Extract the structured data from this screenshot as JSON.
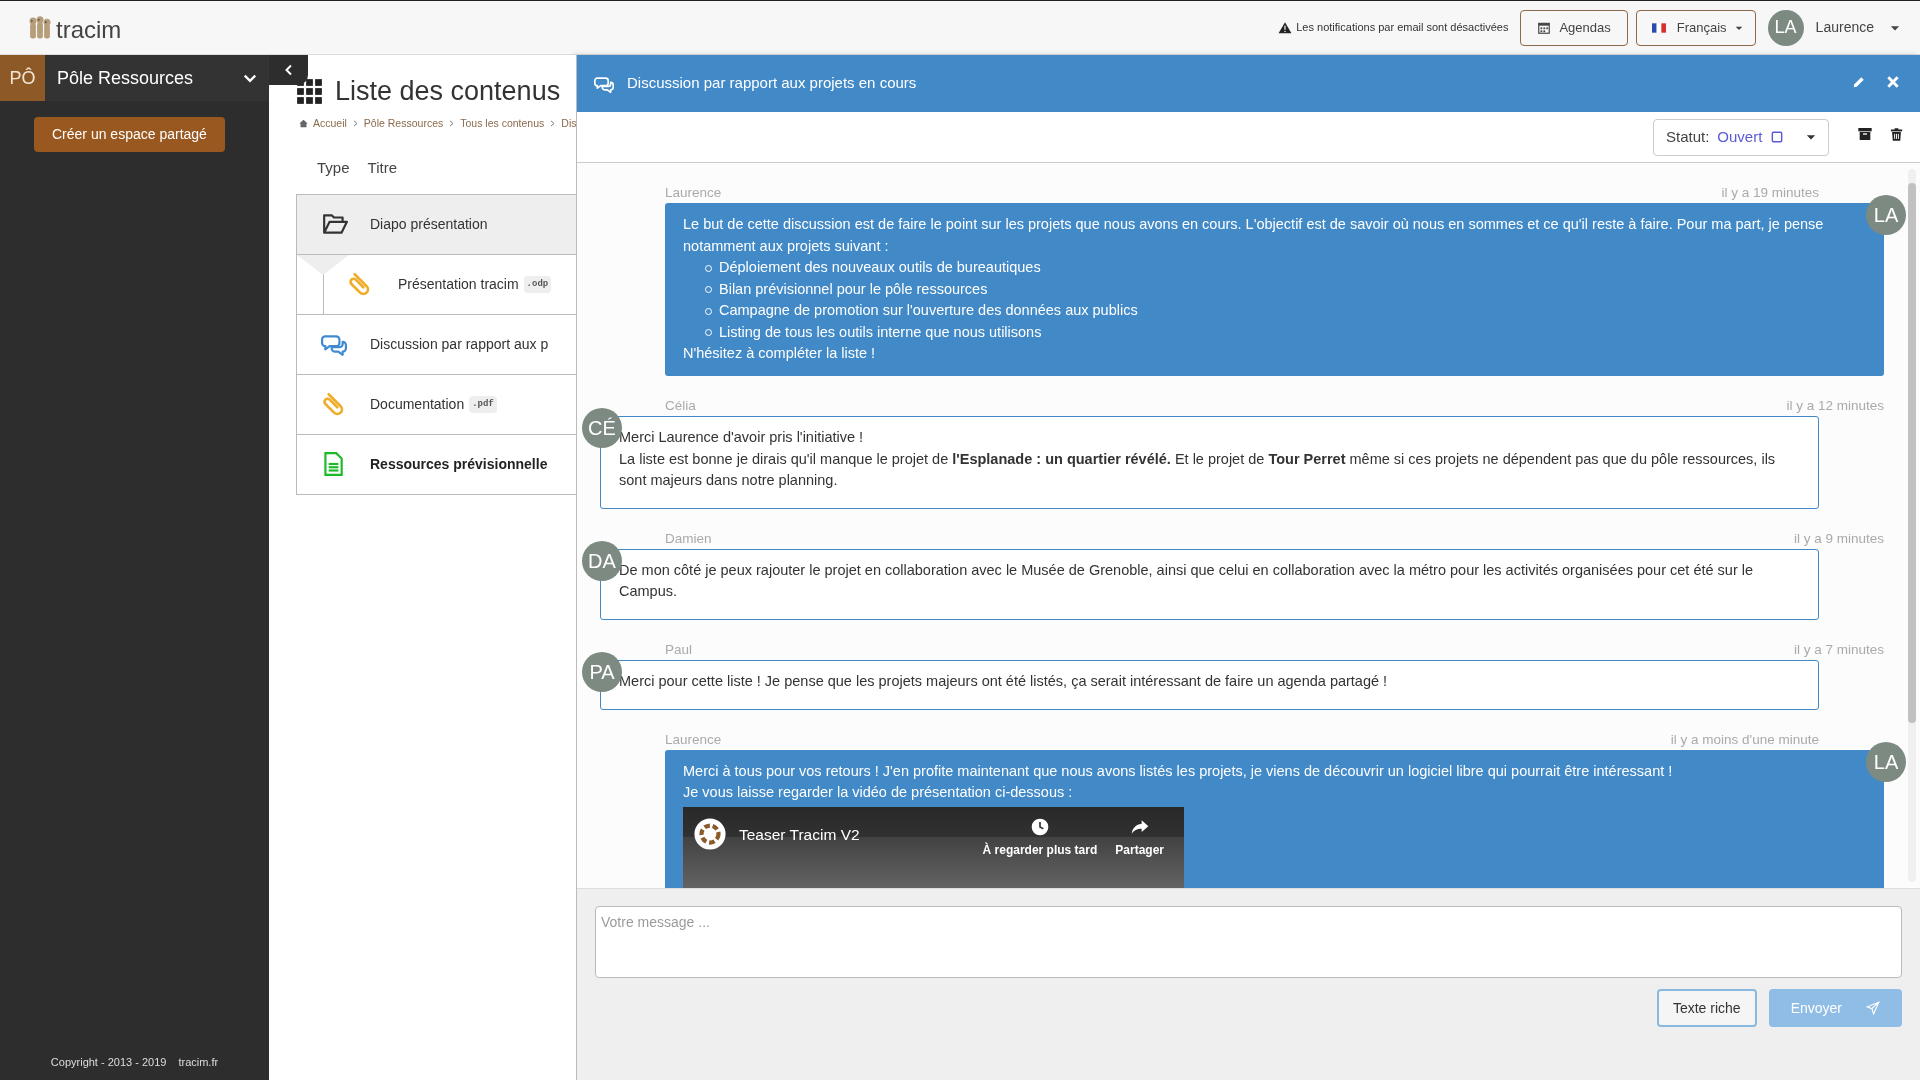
{
  "topbar": {
    "logo_text": "tracim",
    "notice": "Les notifications par email sont désactivées",
    "agendas_button": "Agendas",
    "language_button": "Français",
    "user": {
      "initials": "LA",
      "name": "Laurence"
    }
  },
  "sidebar": {
    "space": {
      "initials": "PÔ",
      "name": "Pôle Ressources"
    },
    "create_button": "Créer un espace partagé",
    "copyright": "Copyright - 2013 - 2019",
    "footer_link": "tracim.fr"
  },
  "content_list": {
    "title": "Liste des contenus",
    "breadcrumb": [
      "Accueil",
      "Pôle Ressources",
      "Tous les contenus",
      "Dis"
    ],
    "columns": [
      "Type",
      "Titre"
    ],
    "items": [
      {
        "kind": "folder",
        "label": "Diapo présentation",
        "expanded": true,
        "unread": false,
        "children": [
          {
            "kind": "file",
            "label": "Présentation tracim",
            "extension": ".odp",
            "unread": false
          }
        ]
      },
      {
        "kind": "thread",
        "label": "Discussion par rapport aux p",
        "unread": false
      },
      {
        "kind": "file",
        "label": "Documentation",
        "extension": ".pdf",
        "unread": false
      },
      {
        "kind": "document",
        "label": "Ressources prévisionnelle",
        "unread": true
      }
    ]
  },
  "discussion": {
    "title": "Discussion par rapport aux projets en cours",
    "status_label": "Statut:",
    "status_value": "Ouvert",
    "messages": [
      {
        "author": "Laurence",
        "initials": "LA",
        "time": "il y a 19 minutes",
        "own": true,
        "blocks": [
          {
            "kind": "p",
            "text": "Le but de cette discussion est de faire le point sur les projets que nous avons en cours. L'objectif est de savoir où nous en sommes et ce qu'il reste à faire. Pour ma part, je pense notamment aux projets suivant :"
          },
          {
            "kind": "list",
            "items": [
              "Déploiement des nouveaux outils de bureautiques",
              "Bilan prévisionnel pour le pôle ressources",
              "Campagne de promotion sur l'ouverture des données aux publics",
              "Listing de tous les outils interne que nous utilisons"
            ]
          },
          {
            "kind": "p",
            "text": "N'hésitez à compléter la liste !"
          }
        ]
      },
      {
        "author": "Célia",
        "initials": "CÉ",
        "time": "il y a 12 minutes",
        "own": false,
        "blocks": [
          {
            "kind": "p",
            "text": "Merci Laurence d'avoir pris l'initiative !"
          },
          {
            "kind": "p",
            "text": "La liste est bonne je dirais qu'il manque le projet de **l'Esplanade : un quartier révélé.** Et le projet de **Tour Perret** même si ces projets ne dépendent pas que du pôle ressources, ils sont majeurs dans notre planning."
          }
        ]
      },
      {
        "author": "Damien",
        "initials": "DA",
        "time": "il y a 9 minutes",
        "own": false,
        "blocks": [
          {
            "kind": "p",
            "text": "De mon côté je peux rajouter le projet en collaboration avec le Musée de Grenoble, ainsi que celui en collaboration avec la métro pour les activités organisées pour cet été sur le Campus."
          }
        ]
      },
      {
        "author": "Paul",
        "initials": "PA",
        "time": "il y a 7 minutes",
        "own": false,
        "blocks": [
          {
            "kind": "p",
            "text": "Merci pour cette liste ! Je pense que les projets majeurs ont été listés, ça serait intéressant de faire un agenda partagé !"
          }
        ]
      },
      {
        "author": "Laurence",
        "initials": "LA",
        "time": "il y a moins d'une minute",
        "own": true,
        "blocks": [
          {
            "kind": "p",
            "text": "Merci à tous pour vos retours ! J'en profite maintenant que nous avons listés les projets, je viens de découvrir un logiciel libre qui pourrait être intéressant !"
          },
          {
            "kind": "p",
            "text": "Je vous laisse regarder la vidéo de présentation ci-dessous :"
          },
          {
            "kind": "video",
            "title": "Teaser Tracim V2",
            "actions": [
              "À regarder plus tard",
              "Partager"
            ]
          }
        ]
      }
    ],
    "composer": {
      "placeholder": "Votre message ...",
      "rich_text_button": "Texte riche",
      "rich_text_selected": true,
      "send_button": "Envoyer",
      "send_disabled": true
    }
  }
}
